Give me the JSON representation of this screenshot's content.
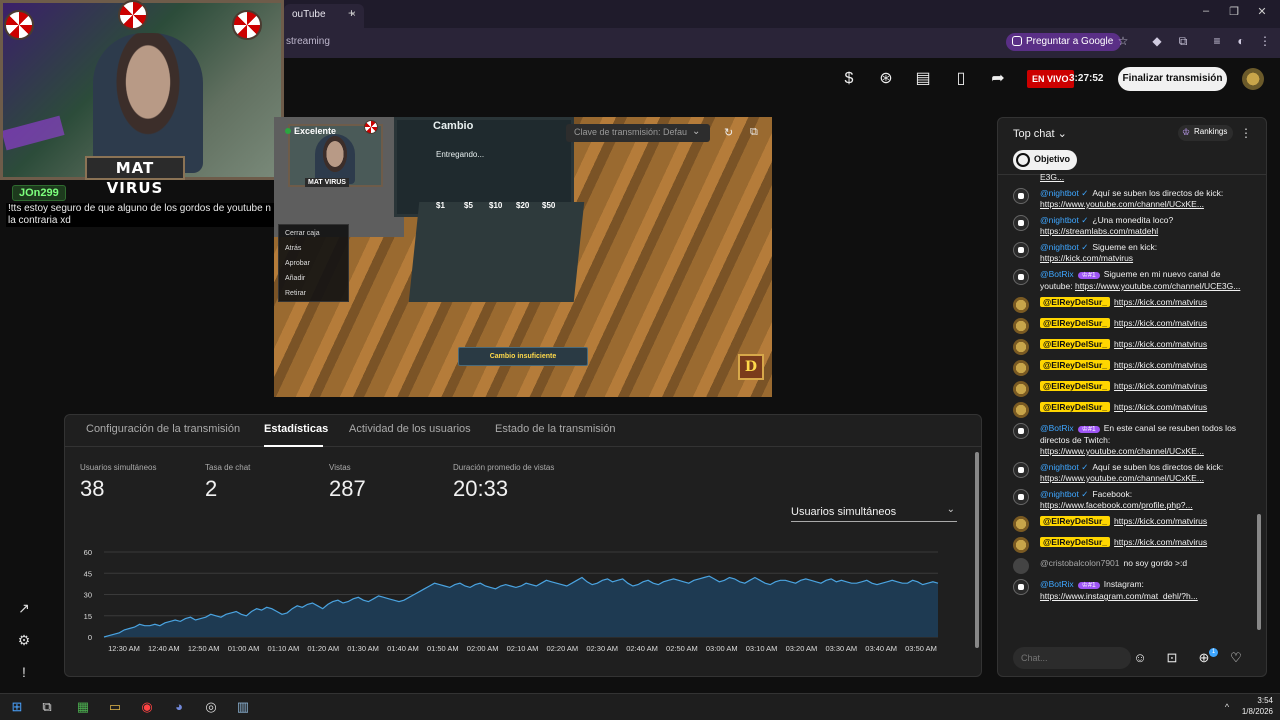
{
  "browser": {
    "tab_title": "ouTube",
    "tab_close": "×",
    "new_tab": "+",
    "url_fragment": "streaming",
    "google_pill": "Preguntar a Google",
    "win_min": "–",
    "win_restore": "❐",
    "win_close": "✕"
  },
  "overlay": {
    "cam_name": "MAT VIRUS",
    "chat_user": "JOn299",
    "chat_message": "!tts estoy seguro de que alguno de los gordos de youtube n la contraria xd",
    "cam2_name": "MAT VIRUS"
  },
  "header": {
    "live_badge": "EN VIVO",
    "live_time": "3:27:52",
    "end_button": "Finalizar transmisión"
  },
  "preview": {
    "quality": "Excelente",
    "stream_key_placeholder": "Clave de transmisión: Defau",
    "game_cash_label": "Cambio",
    "game_entregando": "Entregando...",
    "game_notice": "Cambio insuficiente",
    "game_logo": "D",
    "coins": [
      "$1",
      "$5",
      "$10",
      "$20",
      "$50"
    ],
    "menu_items": [
      "Cerrar caja",
      "Atrás",
      "Aprobar",
      "Añadir",
      "Retirar"
    ]
  },
  "analytics": {
    "tabs": [
      {
        "label": "Configuración de la transmisión"
      },
      {
        "label": "Estadísticas"
      },
      {
        "label": "Actividad de los usuarios"
      },
      {
        "label": "Estado de la transmisión"
      }
    ],
    "stats": [
      {
        "label": "Usuarios simultáneos",
        "value": "38"
      },
      {
        "label": "Tasa de chat",
        "value": "2"
      },
      {
        "label": "Vistas",
        "value": "287"
      },
      {
        "label": "Duración promedio de vistas",
        "value": "20:33"
      }
    ],
    "metric_selected": "Usuarios simultáneos"
  },
  "chart_data": {
    "type": "area",
    "ylim": [
      0,
      60
    ],
    "yticks": [
      0,
      15,
      30,
      45,
      60
    ],
    "x_tick_labels": [
      "12:30 AM",
      "12:40 AM",
      "12:50 AM",
      "01:00 AM",
      "01:10 AM",
      "01:20 AM",
      "01:30 AM",
      "01:40 AM",
      "01:50 AM",
      "02:00 AM",
      "02:10 AM",
      "02:20 AM",
      "02:30 AM",
      "02:40 AM",
      "02:50 AM",
      "03:00 AM",
      "03:10 AM",
      "03:20 AM",
      "03:30 AM",
      "03:40 AM",
      "03:50 AM"
    ],
    "series": [
      {
        "values": [
          0,
          1,
          2,
          3,
          5,
          6,
          7,
          9,
          8,
          8,
          9,
          8,
          10,
          11,
          12,
          11,
          13,
          14,
          12,
          13,
          14,
          16,
          15,
          14,
          16,
          17,
          18,
          16,
          15,
          18,
          20,
          19,
          21,
          20,
          18,
          16,
          17,
          20,
          22,
          21,
          23,
          24,
          22,
          20,
          23,
          25,
          26,
          24,
          25,
          27,
          28,
          26,
          25,
          27,
          29,
          28,
          27,
          26,
          25,
          26,
          28,
          30,
          32,
          34,
          36,
          38,
          37,
          36,
          35,
          37,
          38,
          36,
          35,
          37,
          38,
          36,
          35,
          34,
          36,
          37,
          36,
          35,
          36,
          38,
          37,
          36,
          38,
          40,
          39,
          38,
          37,
          36,
          38,
          40,
          42,
          39,
          37,
          38,
          40,
          41,
          39,
          40,
          41,
          38,
          36,
          37,
          39,
          40,
          38,
          37,
          39,
          40,
          41,
          40,
          39,
          38,
          40,
          41,
          42,
          43,
          41,
          39,
          40,
          42,
          41,
          39,
          38,
          40,
          42,
          40,
          38,
          37,
          39,
          40,
          40,
          39,
          38,
          40,
          41,
          40,
          39,
          38,
          40,
          41,
          39,
          40,
          39,
          38,
          38,
          39,
          40,
          38,
          37,
          38,
          39,
          40,
          39,
          38,
          38,
          40,
          39,
          37,
          38,
          39,
          38
        ]
      }
    ]
  },
  "chat": {
    "header_label": "Top chat",
    "rankings_label": "Rankings",
    "objetivo_label": "Objetivo",
    "input_placeholder": "Chat...",
    "plus_badge": "1",
    "messages": [
      {
        "type": "cont",
        "text": "E3G..."
      },
      {
        "type": "bot",
        "author": "@nightbot",
        "text": "Aquí se suben los directos de kick: ",
        "link": "https://www.youtube.com/channel/UCxKE..."
      },
      {
        "type": "bot",
        "author": "@nightbot",
        "text": "¿Una monedita loco? ",
        "link": "https://streamlabs.com/matdehl"
      },
      {
        "type": "bot",
        "author": "@nightbot",
        "text": "Sigueme en kick: ",
        "link": "https://kick.com/matvirus"
      },
      {
        "type": "botrix",
        "author": "@BotRix",
        "rank": "#1",
        "text": "Sigueme en mi nuevo canal de youtube: ",
        "link": "https://www.youtube.com/channel/UCE3G..."
      },
      {
        "type": "rey",
        "author": "@ElReyDelSur_",
        "link": "https://kick.com/matvirus"
      },
      {
        "type": "rey",
        "author": "@ElReyDelSur_",
        "link": "https://kick.com/matvirus"
      },
      {
        "type": "rey",
        "author": "@ElReyDelSur_",
        "link": "https://kick.com/matvirus"
      },
      {
        "type": "rey",
        "author": "@ElReyDelSur_",
        "link": "https://kick.com/matvirus"
      },
      {
        "type": "rey",
        "author": "@ElReyDelSur_",
        "link": "https://kick.com/matvirus"
      },
      {
        "type": "rey",
        "author": "@ElReyDelSur_",
        "link": "https://kick.com/matvirus"
      },
      {
        "type": "botrix",
        "author": "@BotRix",
        "rank": "#1",
        "text": "En este canal se resuben todos los directos de Twitch: ",
        "link": "https://www.youtube.com/channel/UCxKE..."
      },
      {
        "type": "bot",
        "author": "@nightbot",
        "text": "Aquí se suben los directos de kick: ",
        "link": "https://www.youtube.com/channel/UCxKE..."
      },
      {
        "type": "bot",
        "author": "@nightbot",
        "text": "Facebook: ",
        "link": "https://www.facebook.com/profile.php?..."
      },
      {
        "type": "rey",
        "author": "@ElReyDelSur_",
        "link": "https://kick.com/matvirus"
      },
      {
        "type": "rey",
        "author": "@ElReyDelSur_",
        "link": "https://kick.com/matvirus"
      },
      {
        "type": "cris",
        "author": "@cristobalcolon7901",
        "text": "no soy gordo >:d"
      },
      {
        "type": "botrix",
        "author": "@BotRix",
        "rank": "#1",
        "text": "Instagram: ",
        "link": "https://www.instagram.com/mat_dehl/?h..."
      }
    ]
  },
  "taskbar": {
    "time": "3:54",
    "date": "1/8/2026"
  }
}
